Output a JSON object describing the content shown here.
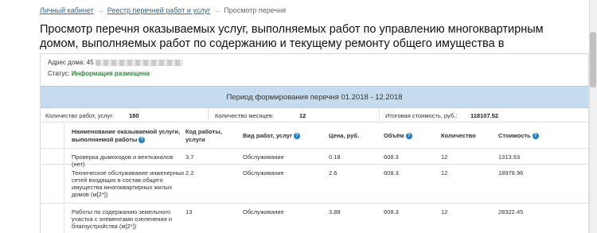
{
  "breadcrumb": {
    "items": [
      {
        "label": "Личный кабинет",
        "link": true
      },
      {
        "label": "Реестр перечней работ и услуг",
        "link": true
      },
      {
        "label": "Просмотр перечня",
        "link": false
      }
    ],
    "separator": "→"
  },
  "page_title": "Просмотр перечня оказываемых услуг, выполняемых работ по управлению многоквартирным домом, выполняемых работ по содержанию и текущему ремонту общего имущества в многоквартирном доме",
  "info": {
    "address_label": "Адрес дома:",
    "address_value": "45",
    "status_label": "Статус:",
    "status_value": "Информация размещена"
  },
  "period": "Период формирования перечня 01.2018 - 12.2018",
  "summary": {
    "works_count_label": "Количество работ, услуг:",
    "works_count_value": "180",
    "months_label": "Количество месяцев:",
    "months_value": "12",
    "total_label": "Итоговая стоимость, руб.:",
    "total_value": "118107.52"
  },
  "table": {
    "headers": {
      "name": "Наименование оказываемой услуги, выполняемой работы",
      "code": "Код работы, услуги",
      "type": "Вид работ, услуг",
      "price": "Цена, руб.",
      "volume": "Объём",
      "quantity": "Количество",
      "cost": "Стоимость"
    },
    "rows": [
      {
        "name": "Проверка дымоходов и вентканалов (нет)",
        "code": "3.7",
        "type": "Обслуживание",
        "price": "0.18",
        "volume": "608.3",
        "quantity": "12",
        "cost": "1313.93"
      },
      {
        "name": "Техническое обслуживание инженерных сетей входящих в состав общего имущества многоквартирных жилых домов (м[2*])",
        "code": "2.2",
        "type": "Обслуживание",
        "price": "2.6",
        "volume": "608.3",
        "quantity": "12",
        "cost": "18978.96"
      },
      {
        "name": "Работы по содержанию земельного участка с элементами озеленения и благоустройства (м[2*])",
        "code": "13",
        "type": "Обслуживание",
        "price": "3.88",
        "volume": "608.3",
        "quantity": "12",
        "cost": "28322.45"
      }
    ]
  },
  "icons": {
    "help": "question-circle-icon"
  },
  "colors": {
    "link": "#1a6fb0",
    "status": "#2e8b3d",
    "period_band": "#c5dcef",
    "help_icon": "#1c7fd0"
  }
}
